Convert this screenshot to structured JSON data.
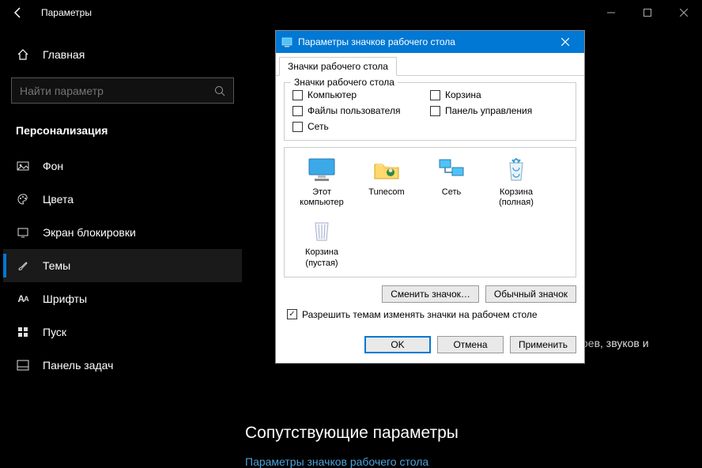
{
  "window": {
    "title": "Параметры",
    "minimize": "—",
    "maximize": "▢",
    "close": "✕"
  },
  "sidebar": {
    "home": "Главная",
    "search_placeholder": "Найти параметр",
    "section": "Персонализация",
    "items": [
      {
        "label": "Фон"
      },
      {
        "label": "Цвета"
      },
      {
        "label": "Экран блокировки"
      },
      {
        "label": "Темы"
      },
      {
        "label": "Шрифты"
      },
      {
        "label": "Пуск"
      },
      {
        "label": "Панель задач"
      }
    ]
  },
  "main": {
    "bg_text_fragment": "боев, звуков и",
    "related_heading": "Сопутствующие параметры",
    "related_link": "Параметры значков рабочего стола"
  },
  "dialog": {
    "title": "Параметры значков рабочего стола",
    "tab": "Значки рабочего стола",
    "group_legend": "Значки рабочего стола",
    "checks": {
      "computer": "Компьютер",
      "userfiles": "Файлы пользователя",
      "network": "Сеть",
      "recycle": "Корзина",
      "cpanel": "Панель управления"
    },
    "icons": {
      "this_pc_l1": "Этот",
      "this_pc_l2": "компьютер",
      "tunecom": "Tunecom",
      "net": "Сеть",
      "bin_full_l1": "Корзина",
      "bin_full_l2": "(полная)",
      "bin_empty_l1": "Корзина",
      "bin_empty_l2": "(пустая)"
    },
    "change_icon": "Сменить значок…",
    "default_icon": "Обычный значок",
    "allow_themes": "Разрешить темам изменять значки на рабочем столе",
    "ok": "OK",
    "cancel": "Отмена",
    "apply": "Применить"
  }
}
